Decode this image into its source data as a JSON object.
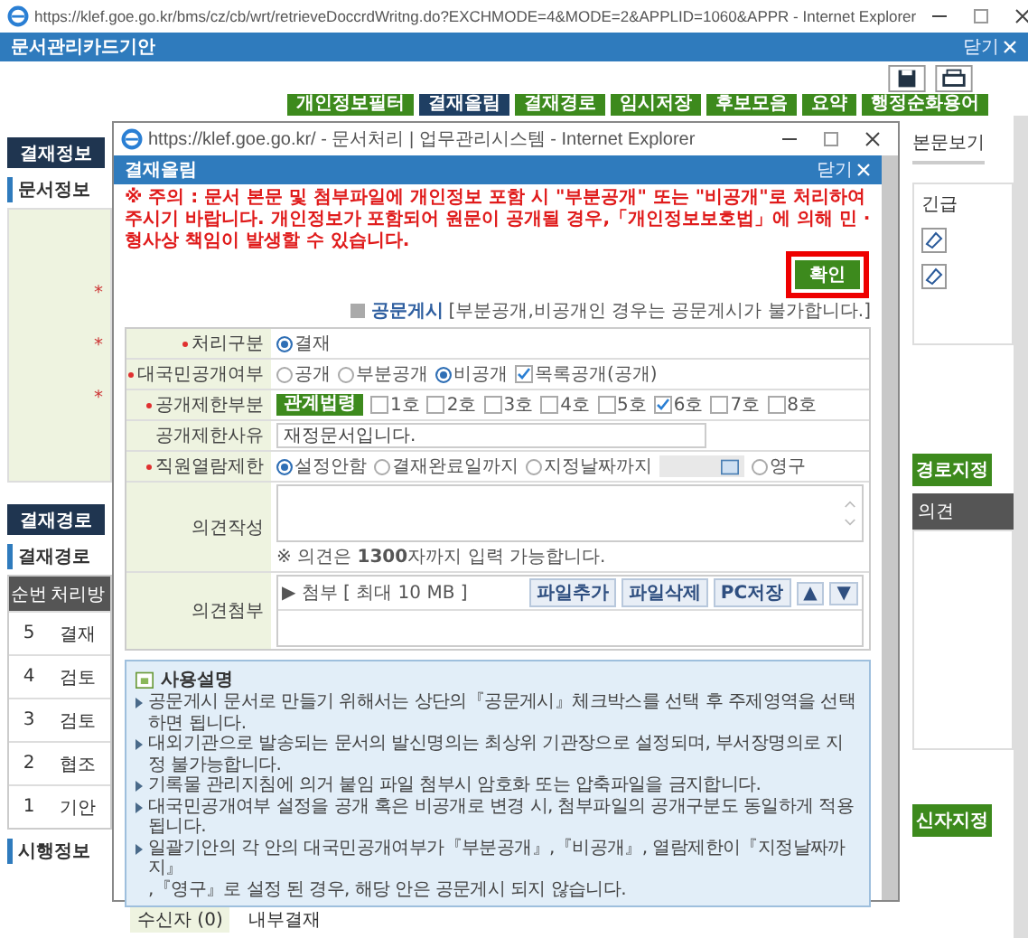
{
  "browser_window": {
    "title": "https://klef.goe.go.kr/bms/cz/cb/wrt/retrieveDoccrdWritng.do?EXCHMODE=4&MODE=2&APPLID=1060&APPR - Internet Explorer"
  },
  "page": {
    "title": "문서관리카드기안",
    "close": "닫기"
  },
  "toolbar_buttons": [
    {
      "label": "개인정보필터",
      "selected": false
    },
    {
      "label": "결재올림",
      "selected": true
    },
    {
      "label": "결재경로",
      "selected": false
    },
    {
      "label": "임시저장",
      "selected": false
    },
    {
      "label": "후보모음",
      "selected": false
    },
    {
      "label": "요약",
      "selected": false
    },
    {
      "label": "행정순화용어",
      "selected": false
    }
  ],
  "left_panel": {
    "tab": "결재정보",
    "section": "문서정보",
    "form_labels": [
      "*",
      "*",
      "*"
    ],
    "route_tab": "결재경로",
    "route_section": "결재경로",
    "route_columns": [
      "순번",
      "처리방"
    ],
    "route_rows": [
      [
        "5",
        "결재"
      ],
      [
        "4",
        "검토"
      ],
      [
        "3",
        "검토"
      ],
      [
        "2",
        "협조"
      ],
      [
        "1",
        "기안"
      ]
    ],
    "enforcement_section": "시행정보"
  },
  "right_panel": {
    "view_body": "본문보기",
    "urgent": "긴급",
    "route_button": "경로지정",
    "opinion_column": "의견",
    "recipient_button": "신자지정"
  },
  "bottom_row": {
    "label": "수신자 (0)",
    "value": "내부결재"
  },
  "popup": {
    "window_title": "https://klef.goe.go.kr/ - 문서처리 | 업무관리시스템 - Internet Explorer",
    "header": "결재올림",
    "close": "닫기",
    "warning": "※ 주의 : 문서 본문 및 첨부파일에 개인정보 포함 시 \"부분공개\" 또는 \"비공개\"로 처리하여 주시기 바랍니다. 개인정보가 포함되어 원문이 공개될 경우,「개인정보보호법」에 의해 민 · 형사상 책임이 발생할 수 있습니다.",
    "confirm": "확인",
    "posting": {
      "label": "공문게시",
      "checked": false,
      "note": "[부분공개,비공개인 경우는 공문게시가 불가합니다.]"
    },
    "rows": [
      {
        "kind": "radio",
        "label": "처리구분",
        "required": true,
        "options": [
          {
            "label": "결재",
            "selected": true
          }
        ]
      },
      {
        "kind": "radio",
        "label": "대국민공개여부",
        "required": true,
        "options": [
          {
            "label": "공개",
            "selected": false
          },
          {
            "label": "부분공개",
            "selected": false
          },
          {
            "label": "비공개",
            "selected": true
          }
        ],
        "checkbox": {
          "label": "목록공개(공개)",
          "checked": true
        }
      },
      {
        "kind": "checks",
        "label": "공개제한부분",
        "required": true,
        "button": "관계법령",
        "checks": [
          {
            "label": "1호",
            "checked": false
          },
          {
            "label": "2호",
            "checked": false
          },
          {
            "label": "3호",
            "checked": false
          },
          {
            "label": "4호",
            "checked": false
          },
          {
            "label": "5호",
            "checked": false
          },
          {
            "label": "6호",
            "checked": true
          },
          {
            "label": "7호",
            "checked": false
          },
          {
            "label": "8호",
            "checked": false
          }
        ]
      },
      {
        "kind": "text",
        "label": "공개제한사유",
        "required": false,
        "value": "재정문서입니다."
      },
      {
        "kind": "radio",
        "label": "직원열람제한",
        "required": true,
        "options": [
          {
            "label": "설정안함",
            "selected": true
          },
          {
            "label": "결재완료일까지",
            "selected": false
          },
          {
            "label": "지정날짜까지",
            "selected": false
          }
        ],
        "date_field": true,
        "after_options": [
          {
            "label": "영구",
            "selected": false
          }
        ]
      },
      {
        "kind": "textarea",
        "label": "의견작성",
        "required": false,
        "note": "※ 의견은 **1300**자까지 입력 가능합니다."
      },
      {
        "kind": "attach",
        "label": "의견첨부",
        "required": false,
        "caption": "▶ 첨부 [ 최대 10 MB ]",
        "buttons": [
          "파일추가",
          "파일삭제",
          "PC저장",
          "▲",
          "▼"
        ]
      }
    ],
    "usage": {
      "title": "사용설명",
      "items": [
        "공문게시 문서로 만들기 위해서는 상단의『공문게시』체크박스를 선택 후 주제영역을 선택하면 됩니다.",
        "대외기관으로 발송되는 문서의 발신명의는 최상위 기관장으로 설정되며, 부서장명의로 지정 불가능합니다.",
        "기록물 관리지침에 의거 붙임 파일 첨부시 암호화 또는 압축파일을 금지합니다.",
        "대국민공개여부 설정을 공개 혹은 비공개로 변경 시, 첨부파일의 공개구분도 동일하게 적용 됩니다.",
        "일괄기안의 각 안의 대국민공개여부가『부분공개』,『비공개』, 열람제한이『지정날짜까지』\n,『영구』로 설정 된 경우, 해당 안은 공문게시 되지 않습니다."
      ]
    }
  }
}
